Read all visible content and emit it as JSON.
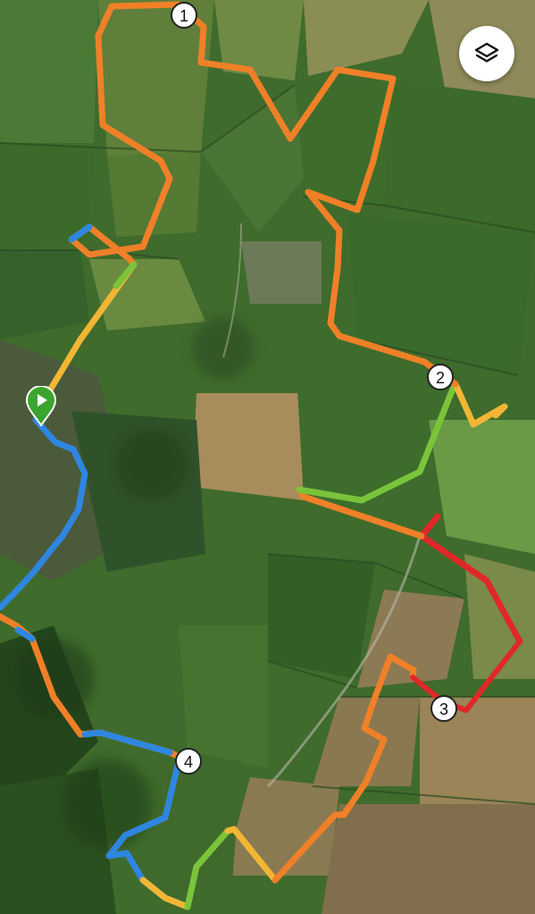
{
  "map": {
    "type": "satellite",
    "route_colors": [
      "#2f86e0",
      "#f08028",
      "#f2b634",
      "#7ac43a",
      "#e02828"
    ],
    "km_markers": [
      {
        "label": "1"
      },
      {
        "label": "2"
      },
      {
        "label": "3"
      },
      {
        "label": "4"
      }
    ]
  },
  "controls": {
    "layers_icon": "layers-icon",
    "start_icon": "start-flag-icon",
    "start_color": "#3aa52e"
  }
}
